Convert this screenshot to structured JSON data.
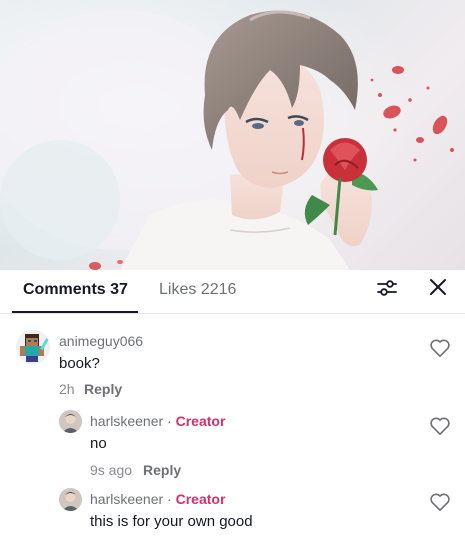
{
  "tabs": {
    "comments_label": "Comments 37",
    "likes_label": "Likes 2216"
  },
  "icons": {
    "filter": "sliders-icon",
    "close": "close-icon",
    "like": "heart-outline-icon"
  },
  "colors": {
    "creator_tag": "#d4306b",
    "active_tab": "#161823",
    "muted_text": "#6f7077"
  },
  "comments": [
    {
      "username": "animeguy066",
      "text": "book?",
      "time": "2h",
      "reply_label": "Reply",
      "is_reply": false
    },
    {
      "username": "harlskeener",
      "separator": "·",
      "badge": "Creator",
      "text": "no",
      "time": "9s ago",
      "reply_label": "Reply",
      "is_reply": true
    },
    {
      "username": "harlskeener",
      "separator": "·",
      "badge": "Creator",
      "text": "this is for your own good",
      "is_reply": true
    }
  ]
}
